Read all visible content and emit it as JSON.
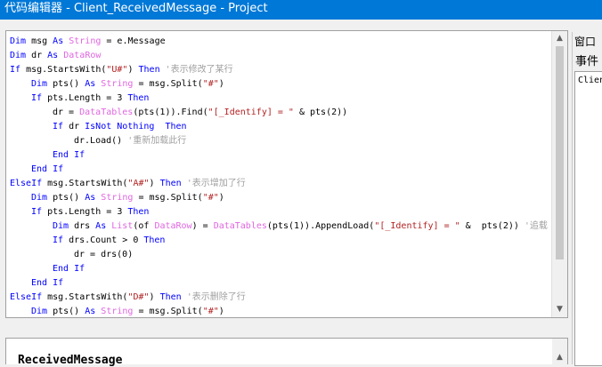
{
  "window": {
    "title": "代码编辑器 - Client_ReceivedMessage - Project"
  },
  "right_panel": {
    "window_tab": "窗口",
    "events_tab": "事件",
    "list_item": "Client"
  },
  "bottom_panel": {
    "label": "ReceivedMessage"
  },
  "code_lines": [
    {
      "indent": 0,
      "tokens": [
        [
          "kw",
          "Dim"
        ],
        [
          "tx",
          " msg "
        ],
        [
          "kw",
          "As"
        ],
        [
          "tx",
          " "
        ],
        [
          "ty",
          "String"
        ],
        [
          "tx",
          " = e.Message"
        ]
      ]
    },
    {
      "indent": 0,
      "tokens": [
        [
          "kw",
          "Dim"
        ],
        [
          "tx",
          " dr "
        ],
        [
          "kw",
          "As"
        ],
        [
          "tx",
          " "
        ],
        [
          "ty",
          "DataRow"
        ]
      ]
    },
    {
      "indent": 0,
      "tokens": [
        [
          "kw",
          "If"
        ],
        [
          "tx",
          " msg.StartsWith("
        ],
        [
          "st",
          "\"U#\""
        ],
        [
          "tx",
          ") "
        ],
        [
          "kw",
          "Then"
        ],
        [
          "cm",
          " '表示修改了某行"
        ]
      ]
    },
    {
      "indent": 1,
      "tokens": [
        [
          "kw",
          "Dim"
        ],
        [
          "tx",
          " pts() "
        ],
        [
          "kw",
          "As"
        ],
        [
          "tx",
          " "
        ],
        [
          "ty",
          "String"
        ],
        [
          "tx",
          " = msg.Split("
        ],
        [
          "st",
          "\"#\""
        ],
        [
          "tx",
          ")"
        ]
      ]
    },
    {
      "indent": 1,
      "tokens": [
        [
          "kw",
          "If"
        ],
        [
          "tx",
          " pts.Length = 3 "
        ],
        [
          "kw",
          "Then"
        ]
      ]
    },
    {
      "indent": 2,
      "tokens": [
        [
          "tx",
          "dr = "
        ],
        [
          "ty",
          "DataTables"
        ],
        [
          "tx",
          "(pts(1)).Find("
        ],
        [
          "st",
          "\"[_Identify] = \""
        ],
        [
          "tx",
          " & pts(2))"
        ]
      ]
    },
    {
      "indent": 2,
      "tokens": [
        [
          "kw",
          "If"
        ],
        [
          "tx",
          " dr "
        ],
        [
          "kw",
          "IsNot Nothing"
        ],
        [
          "tx",
          "  "
        ],
        [
          "kw",
          "Then"
        ]
      ]
    },
    {
      "indent": 3,
      "tokens": [
        [
          "tx",
          "dr.Load() "
        ],
        [
          "cm",
          "'重新加载此行"
        ]
      ]
    },
    {
      "indent": 2,
      "tokens": [
        [
          "kw",
          "End If"
        ]
      ]
    },
    {
      "indent": 1,
      "tokens": [
        [
          "kw",
          "End If"
        ]
      ]
    },
    {
      "indent": 0,
      "tokens": [
        [
          "kw",
          "ElseIf"
        ],
        [
          "tx",
          " msg.StartsWith("
        ],
        [
          "st",
          "\"A#\""
        ],
        [
          "tx",
          ") "
        ],
        [
          "kw",
          "Then"
        ],
        [
          "cm",
          " '表示增加了行"
        ]
      ]
    },
    {
      "indent": 1,
      "tokens": [
        [
          "kw",
          "Dim"
        ],
        [
          "tx",
          " pts() "
        ],
        [
          "kw",
          "As"
        ],
        [
          "tx",
          " "
        ],
        [
          "ty",
          "String"
        ],
        [
          "tx",
          " = msg.Split("
        ],
        [
          "st",
          "\"#\""
        ],
        [
          "tx",
          ")"
        ]
      ]
    },
    {
      "indent": 1,
      "tokens": [
        [
          "kw",
          "If"
        ],
        [
          "tx",
          " pts.Length = 3 "
        ],
        [
          "kw",
          "Then"
        ]
      ]
    },
    {
      "indent": 2,
      "tokens": [
        [
          "kw",
          "Dim"
        ],
        [
          "tx",
          " drs "
        ],
        [
          "kw",
          "As"
        ],
        [
          "tx",
          " "
        ],
        [
          "ty",
          "List"
        ],
        [
          "tx",
          "(of "
        ],
        [
          "ty",
          "DataRow"
        ],
        [
          "tx",
          ") = "
        ],
        [
          "ty",
          "DataTables"
        ],
        [
          "tx",
          "(pts(1)).AppendLoad("
        ],
        [
          "st",
          "\"[_Identify] = \""
        ],
        [
          "tx",
          " &  pts(2)) "
        ],
        [
          "cm",
          "'追载"
        ]
      ]
    },
    {
      "indent": 2,
      "tokens": [
        [
          "kw",
          "If"
        ],
        [
          "tx",
          " drs.Count > 0 "
        ],
        [
          "kw",
          "Then"
        ]
      ]
    },
    {
      "indent": 3,
      "tokens": [
        [
          "tx",
          "dr = drs(0)"
        ]
      ]
    },
    {
      "indent": 2,
      "tokens": [
        [
          "kw",
          "End If"
        ]
      ]
    },
    {
      "indent": 1,
      "tokens": [
        [
          "kw",
          "End If"
        ]
      ]
    },
    {
      "indent": 0,
      "tokens": [
        [
          "kw",
          "ElseIf"
        ],
        [
          "tx",
          " msg.StartsWith("
        ],
        [
          "st",
          "\"D#\""
        ],
        [
          "tx",
          ") "
        ],
        [
          "kw",
          "Then"
        ],
        [
          "cm",
          " '表示删除了行"
        ]
      ]
    },
    {
      "indent": 1,
      "tokens": [
        [
          "kw",
          "Dim"
        ],
        [
          "tx",
          " pts() "
        ],
        [
          "kw",
          "As"
        ],
        [
          "tx",
          " "
        ],
        [
          "ty",
          "String"
        ],
        [
          "tx",
          " = msg.Split("
        ],
        [
          "st",
          "\"#\""
        ],
        [
          "tx",
          ")"
        ]
      ]
    }
  ],
  "scrollbar": {
    "up_icon": "arrow-up-icon",
    "down_icon": "arrow-down-icon"
  },
  "colors": {
    "titlebar": "#0078d7",
    "keyword": "#0000ff",
    "type": "#e066e0",
    "string": "#b22222",
    "comment": "#a0a0a0"
  }
}
